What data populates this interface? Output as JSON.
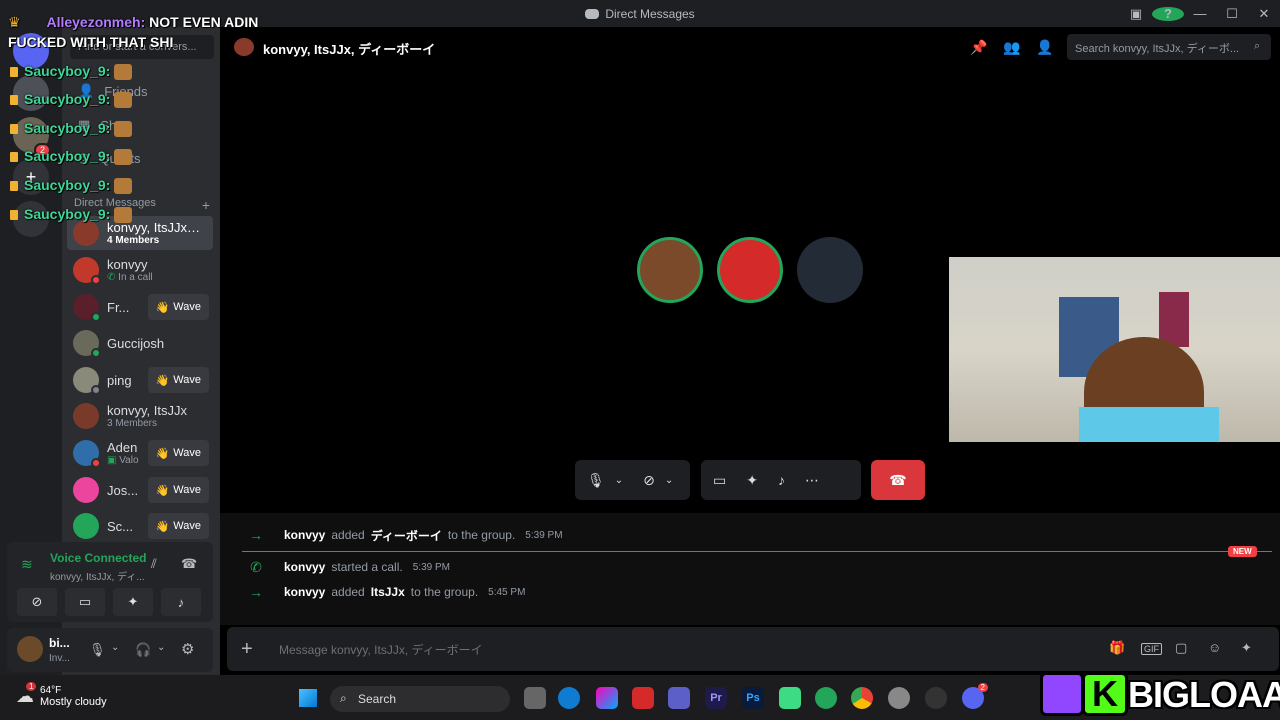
{
  "window": {
    "title": "Direct Messages"
  },
  "sidebar": {
    "find_placeholder": "Find or start a convers...",
    "nav": [
      {
        "label": "Friends"
      },
      {
        "label": "Shop"
      },
      {
        "label": "Quests"
      }
    ],
    "dm_header": "Direct Messages",
    "dms": [
      {
        "name": "konvyy, ItsJJx, ...",
        "sub": "4 Members"
      },
      {
        "name": "konvyy",
        "sub": "In a call"
      },
      {
        "name": "Fr...",
        "sub": ""
      },
      {
        "name": "Guccijosh",
        "sub": ""
      },
      {
        "name": "ping",
        "sub": ""
      },
      {
        "name": "konvyy, ItsJJx",
        "sub": "3 Members"
      },
      {
        "name": "Aden",
        "sub": "Valo"
      },
      {
        "name": "Jos...",
        "sub": ""
      },
      {
        "name": "Sc...",
        "sub": ""
      }
    ],
    "wave_label": "Wave",
    "rail_badge": "2"
  },
  "voice": {
    "title": "Voice Connected",
    "channel": "konvyy, ItsJJx, ディ..."
  },
  "user": {
    "name": "bi...",
    "status": "Inv..."
  },
  "channel": {
    "name": "konvyy, ItsJJx, ディーボーイ",
    "search_placeholder": "Search konvyy, ItsJJx, ディーボ..."
  },
  "messages": [
    {
      "actor": "konvyy",
      "verb": "added",
      "target": "ディーボーイ",
      "tail": "to the group.",
      "time": "5:39 PM"
    },
    {
      "actor": "konvyy",
      "verb": "started a call.",
      "target": "",
      "tail": "",
      "time": "5:39 PM"
    },
    {
      "actor": "konvyy",
      "verb": "added",
      "target": "ItsJJx",
      "tail": "to the group.",
      "time": "5:45 PM"
    }
  ],
  "new_badge": "NEW",
  "composer": {
    "placeholder": "Message konvyy, ItsJJx, ディーボーイ"
  },
  "overlay_chat": [
    {
      "user": "Alleyezonmeh:",
      "text": "NOT EVEN ADIN"
    },
    {
      "user": "",
      "text": "FUCKED WITH THAT SHI"
    },
    {
      "user": "Saucyboy_9:",
      "text": ""
    },
    {
      "user": "Saucyboy_9:",
      "text": ""
    },
    {
      "user": "Saucyboy_9:",
      "text": ""
    },
    {
      "user": "Saucyboy_9:",
      "text": ""
    },
    {
      "user": "Saucyboy_9:",
      "text": ""
    },
    {
      "user": "Saucyboy_9:",
      "text": ""
    }
  ],
  "taskbar": {
    "temp": "64°F",
    "weather": "Mostly cloudy",
    "weather_badge": "1",
    "search": "Search",
    "discord_badge": "2"
  },
  "brand": {
    "name": "BIGLOAAF",
    "k_letter": "K"
  },
  "colors": {
    "accent": "#5865f2",
    "online": "#23a55a",
    "danger": "#da373c",
    "kick": "#53fc18",
    "twitch": "#9146ff"
  }
}
